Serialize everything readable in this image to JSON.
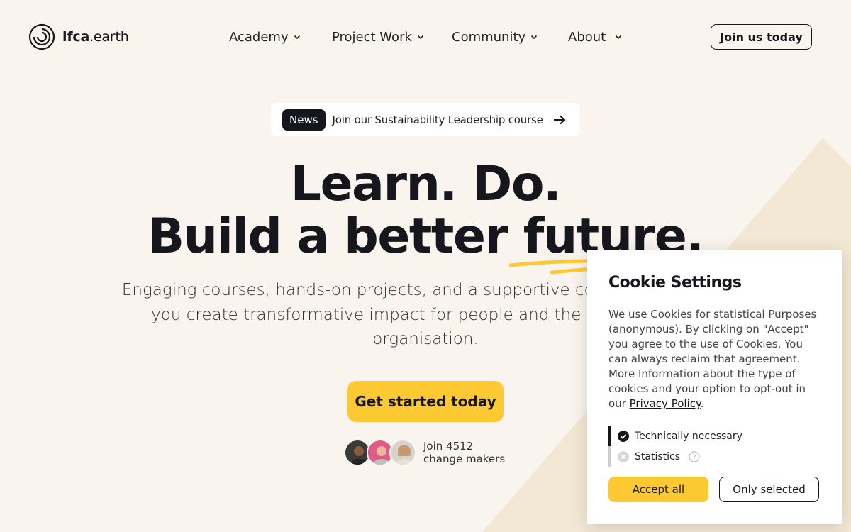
{
  "brand": {
    "name_bold": "lfca",
    "name_rest": ".earth",
    "accent": "#fdc933",
    "dark": "#16161d"
  },
  "nav": {
    "items": [
      {
        "label": "Academy"
      },
      {
        "label": "Project Work"
      },
      {
        "label": "Community"
      },
      {
        "label": "About"
      }
    ],
    "join_label": "Join us today"
  },
  "news": {
    "badge": "News",
    "text": "Join our Sustainability Leadership course"
  },
  "hero": {
    "title_line1": "Learn. Do.",
    "title_line2": "Build a better future.",
    "subtitle": "Engaging courses, hands-on projects, and a supportive community to help you create transformative impact for people and the planet in your organisation.",
    "cta_label": "Get started today",
    "makers_line1": "Join 4512",
    "makers_line2": "change makers"
  },
  "cookie": {
    "title": "Cookie Settings",
    "text_before": "We use Cookies for statistical Purposes (anonymous). By clicking on \"Accept\" you agree to the use of Cookies. You can always reclaim that agreement. More Information about the type of cookies and your option to opt-out in our ",
    "link_label": "Privacy Policy",
    "text_after": ".",
    "options": [
      {
        "label": "Technically necessary",
        "checked": true
      },
      {
        "label": "Statistics",
        "checked": false
      }
    ],
    "accept_label": "Accept all",
    "only_label": "Only selected"
  }
}
